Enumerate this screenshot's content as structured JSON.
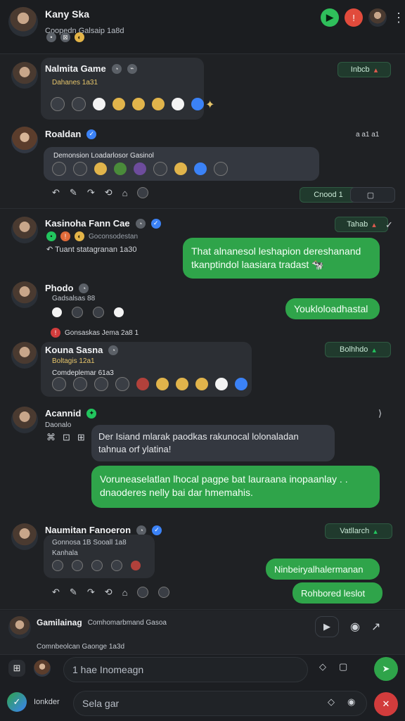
{
  "header": {
    "title": "Kany Ska",
    "subtitle": "Coopedn Galsaip 1a8d",
    "more": "⋮"
  },
  "messages": [
    {
      "name": "Nalmita Game",
      "tag": "Dahanes 1a31",
      "pill": "Inbcb",
      "more": ""
    },
    {
      "name": "Roaldan",
      "line": "Demonsion Loadarlosor Gasinol",
      "time": "a a1 a1",
      "pill": "Cnood 1",
      "react": ""
    },
    {
      "name": "Kasinoha Fann Cae",
      "sub": "Goconsodestan",
      "reply": "Tuant statagranan 1a30",
      "pill": "Tahab",
      "bubble": "That alnanesol leshapion dereshanand tkanptindol laasiara tradast 🐄"
    },
    {
      "name": "Phodo",
      "sub": "Gadsalsas 88",
      "bubble": "Youkloloadhastal",
      "mention": "Gonsaskas Jema 2a8 1"
    },
    {
      "name": "Kouna Sasna",
      "tag": "Boltagis 12a1",
      "line": "Comdeplemar 61a3",
      "pill": "Bolhhdo"
    },
    {
      "name": "Acannid",
      "sub": "Daonalo",
      "greyBubble": "Der Isiand mlarak paodkas rakunocal lolonaladan tahnua orf ylatina!",
      "bubble": "Voruneaselatlan lhocal pagpe bat lauraana inopaanlay . . dnaoderes nelly bai dar hmemahis."
    },
    {
      "name": "Naumitan Fanoeron",
      "sub1": "Gonnosa 1B Sooall 1a8",
      "sub2": "Kanhala",
      "pill": "Vatllarch",
      "bubble1": "Ninbeiryalhalermanan",
      "bubble2": "Rohbored leslot"
    },
    {
      "name": "Gamilainag",
      "sub": "Comhomarbmand Gasoa",
      "line": "Comnbeolcan Gaonge 1a3d"
    }
  ],
  "composer": {
    "placeholder": "1 hae Inomeagn",
    "search_placeholder": "Sela gar",
    "side_label": "Ionkder"
  },
  "colors": {
    "accent": "#2fa44a",
    "bg": "#1f2124",
    "card": "#2c2f34"
  },
  "icons": {
    "video": "camera-icon",
    "call": "phone-icon",
    "add": "plus-icon",
    "search": "search-icon",
    "send": "send-icon"
  }
}
